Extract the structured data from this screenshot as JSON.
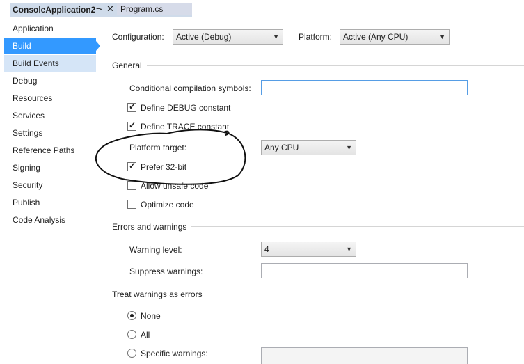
{
  "tabs": {
    "active": "ConsoleApplication2",
    "inactive": "Program.cs",
    "pin_icon": "pin-icon",
    "close_icon": "close-icon"
  },
  "sidebar": {
    "items": [
      {
        "label": "Application"
      },
      {
        "label": "Build",
        "selected": true
      },
      {
        "label": "Build Events",
        "hover": true
      },
      {
        "label": "Debug"
      },
      {
        "label": "Resources"
      },
      {
        "label": "Services"
      },
      {
        "label": "Settings"
      },
      {
        "label": "Reference Paths"
      },
      {
        "label": "Signing"
      },
      {
        "label": "Security"
      },
      {
        "label": "Publish"
      },
      {
        "label": "Code Analysis"
      }
    ]
  },
  "config": {
    "configuration_label": "Configuration:",
    "configuration_value": "Active (Debug)",
    "platform_label": "Platform:",
    "platform_value": "Active (Any CPU)"
  },
  "general": {
    "title": "General",
    "symbols_label": "Conditional compilation symbols:",
    "symbols_value": "",
    "debug_label": "Define DEBUG constant",
    "debug_checked": true,
    "trace_label": "Define TRACE constant",
    "trace_checked": true,
    "platform_target_label": "Platform target:",
    "platform_target_value": "Any CPU",
    "prefer32_label": "Prefer 32-bit",
    "prefer32_checked": true,
    "unsafe_label": "Allow unsafe code",
    "unsafe_checked": false,
    "optimize_label": "Optimize code",
    "optimize_checked": false
  },
  "errors": {
    "title": "Errors and warnings",
    "warning_level_label": "Warning level:",
    "warning_level_value": "4",
    "suppress_label": "Suppress warnings:",
    "suppress_value": ""
  },
  "treat": {
    "title": "Treat warnings as errors",
    "none_label": "None",
    "all_label": "All",
    "specific_label": "Specific warnings:",
    "selected": "None"
  }
}
